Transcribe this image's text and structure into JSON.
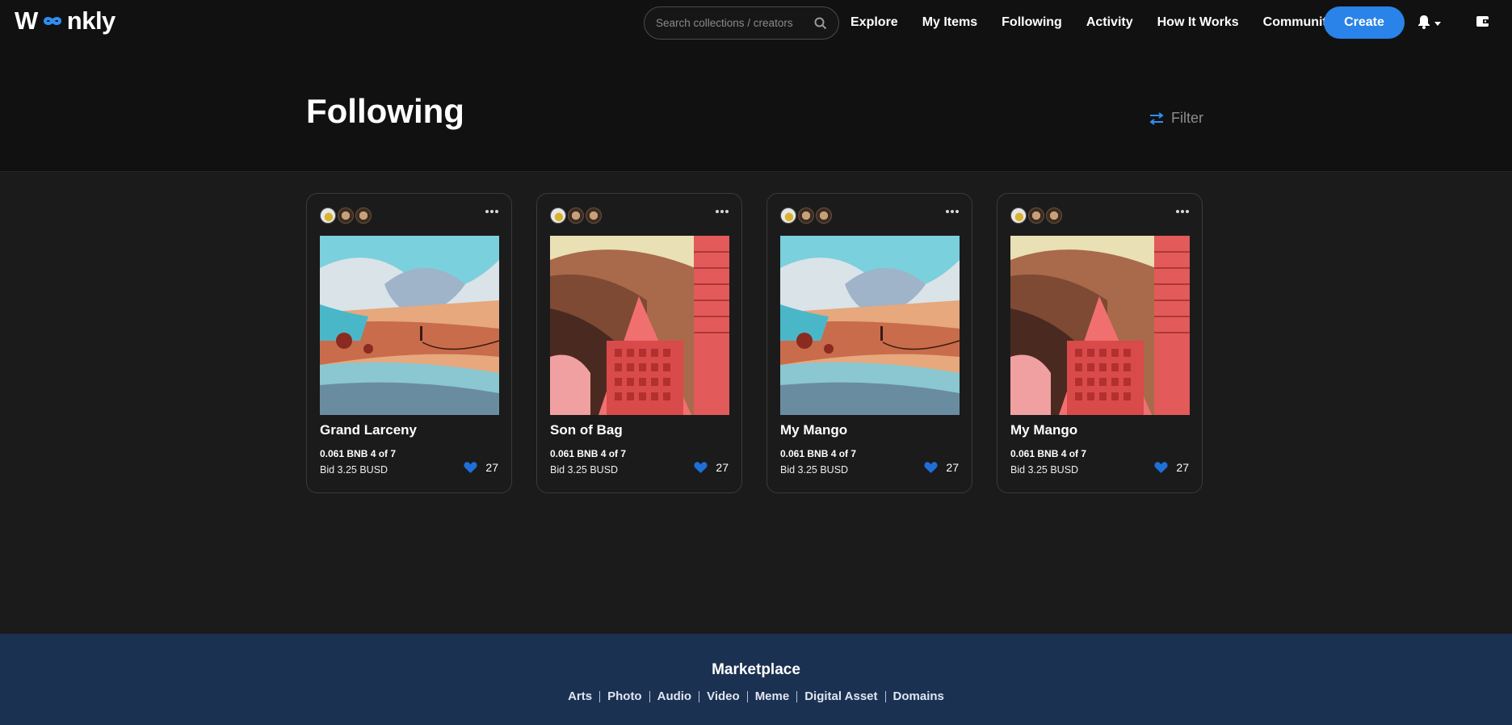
{
  "brand": {
    "name_left": "W",
    "name_right": "nkly",
    "accent": "#2e8ef0"
  },
  "search": {
    "placeholder": "Search collections / creators"
  },
  "nav": {
    "items": [
      {
        "label": "Explore"
      },
      {
        "label": "My Items"
      },
      {
        "label": "Following"
      },
      {
        "label": "Activity"
      },
      {
        "label": "How It Works"
      },
      {
        "label": "Community"
      }
    ],
    "create_label": "Create"
  },
  "page": {
    "title": "Following",
    "filter_label": "Filter"
  },
  "cards": [
    {
      "title": "Grand Larceny",
      "price": "0.061 BNB 4 of 7",
      "bid": "Bid 3.25 BUSD",
      "likes": "27",
      "art": "desert-landscape"
    },
    {
      "title": "Son of Bag",
      "price": "0.061 BNB 4 of 7",
      "bid": "Bid 3.25 BUSD",
      "likes": "27",
      "art": "red-tower"
    },
    {
      "title": "My Mango",
      "price": "0.061 BNB 4 of 7",
      "bid": "Bid 3.25 BUSD",
      "likes": "27",
      "art": "desert-landscape"
    },
    {
      "title": "My Mango",
      "price": "0.061 BNB 4 of 7",
      "bid": "Bid 3.25 BUSD",
      "likes": "27",
      "art": "red-tower"
    }
  ],
  "footer": {
    "title": "Marketplace",
    "links": [
      "Arts",
      "Photo",
      "Audio",
      "Video",
      "Meme",
      "Digital Asset",
      "Domains"
    ]
  },
  "colors": {
    "primary": "#2a83e8",
    "footer_bg": "#1b3152",
    "heart": "#1f6fd8"
  }
}
